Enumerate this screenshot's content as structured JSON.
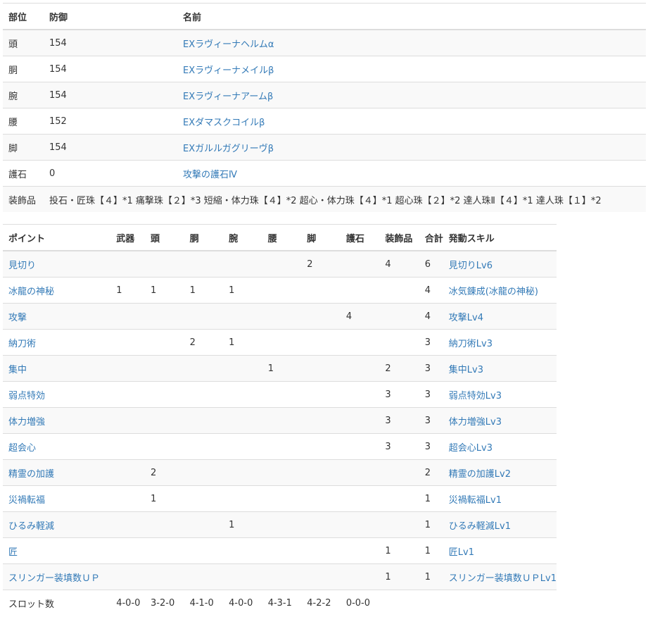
{
  "armor": {
    "headers": {
      "part": "部位",
      "defense": "防御",
      "name": "名前"
    },
    "rows": [
      {
        "part": "頭",
        "defense": "154",
        "name": "EXラヴィーナヘルムα"
      },
      {
        "part": "胴",
        "defense": "154",
        "name": "EXラヴィーナメイルβ"
      },
      {
        "part": "腕",
        "defense": "154",
        "name": "EXラヴィーナアームβ"
      },
      {
        "part": "腰",
        "defense": "152",
        "name": "EXダマスクコイルβ"
      },
      {
        "part": "脚",
        "defense": "154",
        "name": "EXガルルガグリーヴβ"
      },
      {
        "part": "護石",
        "defense": "0",
        "name": "攻撃の護石Ⅳ"
      }
    ],
    "decorations": {
      "label": "装飾品",
      "value": "投石・匠珠【４】*1 痛撃珠【２】*3 短縮・体力珠【４】*2 超心・体力珠【４】*1 超心珠【２】*2 達人珠Ⅱ【４】*1 達人珠【１】*2"
    }
  },
  "skills": {
    "headers": {
      "point": "ポイント",
      "weapon": "武器",
      "head": "頭",
      "body": "胴",
      "arm": "腕",
      "waist": "腰",
      "leg": "脚",
      "charm": "護石",
      "deco": "装飾品",
      "total": "合計",
      "skill": "発動スキル"
    },
    "rows": [
      {
        "point": "見切り",
        "weapon": "",
        "head": "",
        "body": "",
        "arm": "",
        "waist": "",
        "leg": "2",
        "charm": "",
        "deco": "4",
        "total": "6",
        "skill": "見切りLv6"
      },
      {
        "point": "冰龍の神秘",
        "weapon": "1",
        "head": "1",
        "body": "1",
        "arm": "1",
        "waist": "",
        "leg": "",
        "charm": "",
        "deco": "",
        "total": "4",
        "skill": "冰気錬成(冰龍の神秘)"
      },
      {
        "point": "攻撃",
        "weapon": "",
        "head": "",
        "body": "",
        "arm": "",
        "waist": "",
        "leg": "",
        "charm": "4",
        "deco": "",
        "total": "4",
        "skill": "攻撃Lv4"
      },
      {
        "point": "納刀術",
        "weapon": "",
        "head": "",
        "body": "2",
        "arm": "1",
        "waist": "",
        "leg": "",
        "charm": "",
        "deco": "",
        "total": "3",
        "skill": "納刀術Lv3"
      },
      {
        "point": "集中",
        "weapon": "",
        "head": "",
        "body": "",
        "arm": "",
        "waist": "1",
        "leg": "",
        "charm": "",
        "deco": "2",
        "total": "3",
        "skill": "集中Lv3"
      },
      {
        "point": "弱点特効",
        "weapon": "",
        "head": "",
        "body": "",
        "arm": "",
        "waist": "",
        "leg": "",
        "charm": "",
        "deco": "3",
        "total": "3",
        "skill": "弱点特効Lv3"
      },
      {
        "point": "体力増強",
        "weapon": "",
        "head": "",
        "body": "",
        "arm": "",
        "waist": "",
        "leg": "",
        "charm": "",
        "deco": "3",
        "total": "3",
        "skill": "体力増強Lv3"
      },
      {
        "point": "超会心",
        "weapon": "",
        "head": "",
        "body": "",
        "arm": "",
        "waist": "",
        "leg": "",
        "charm": "",
        "deco": "3",
        "total": "3",
        "skill": "超会心Lv3"
      },
      {
        "point": "精霊の加護",
        "weapon": "",
        "head": "2",
        "body": "",
        "arm": "",
        "waist": "",
        "leg": "",
        "charm": "",
        "deco": "",
        "total": "2",
        "skill": "精霊の加護Lv2"
      },
      {
        "point": "災禍転福",
        "weapon": "",
        "head": "1",
        "body": "",
        "arm": "",
        "waist": "",
        "leg": "",
        "charm": "",
        "deco": "",
        "total": "1",
        "skill": "災禍転福Lv1"
      },
      {
        "point": "ひるみ軽減",
        "weapon": "",
        "head": "",
        "body": "",
        "arm": "1",
        "waist": "",
        "leg": "",
        "charm": "",
        "deco": "",
        "total": "1",
        "skill": "ひるみ軽減Lv1"
      },
      {
        "point": "匠",
        "weapon": "",
        "head": "",
        "body": "",
        "arm": "",
        "waist": "",
        "leg": "",
        "charm": "",
        "deco": "1",
        "total": "1",
        "skill": "匠Lv1"
      },
      {
        "point": "スリンガー装填数ＵＰ",
        "weapon": "",
        "head": "",
        "body": "",
        "arm": "",
        "waist": "",
        "leg": "",
        "charm": "",
        "deco": "1",
        "total": "1",
        "skill": "スリンガー装填数ＵＰLv1"
      }
    ],
    "slots": {
      "label": "スロット数",
      "weapon": "4-0-0",
      "head": "3-2-0",
      "body": "4-1-0",
      "arm": "4-0-0",
      "waist": "4-3-1",
      "leg": "4-2-2",
      "charm": "0-0-0"
    }
  }
}
